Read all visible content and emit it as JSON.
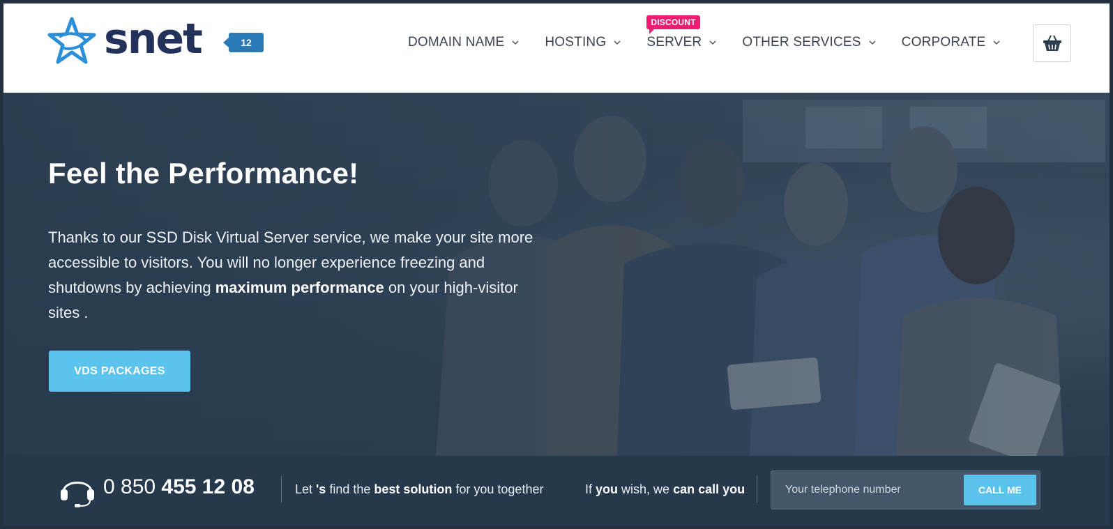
{
  "header": {
    "logo_text": "snet",
    "badge": "12",
    "nav": [
      {
        "label": "DOMAIN NAME"
      },
      {
        "label": "HOSTING"
      },
      {
        "label": "SERVER",
        "tag": "DISCOUNT"
      },
      {
        "label": "OTHER SERVICES"
      },
      {
        "label": "CORPORATE"
      }
    ],
    "cart_icon": "basket-icon"
  },
  "hero": {
    "title": "Feel the Performance!",
    "text_before": "Thanks to our SSD Disk Virtual Server service, we make your site more accessible to visitors. You will no longer experience freezing and shutdowns by achieving ",
    "text_bold": "maximum performance",
    "text_after": " on your high-visitor sites .",
    "button": "VDS PACKAGES"
  },
  "bar": {
    "phone_prefix": "0 850 ",
    "phone_bold": "455 12 08",
    "slogan_1": "Let ",
    "slogan_2": "'s",
    "slogan_3": " find the ",
    "slogan_4": "best solution",
    "slogan_5": " for you together",
    "callback_1": "If ",
    "callback_2": "you",
    "callback_3": " wish, we ",
    "callback_4": "can call you",
    "tel_placeholder": "Your telephone number",
    "call_button": "CALL ME"
  },
  "colors": {
    "accent": "#5bc3ec",
    "brand_navy": "#23325a",
    "discount": "#ee1d72",
    "badge": "#2a7ab8"
  }
}
